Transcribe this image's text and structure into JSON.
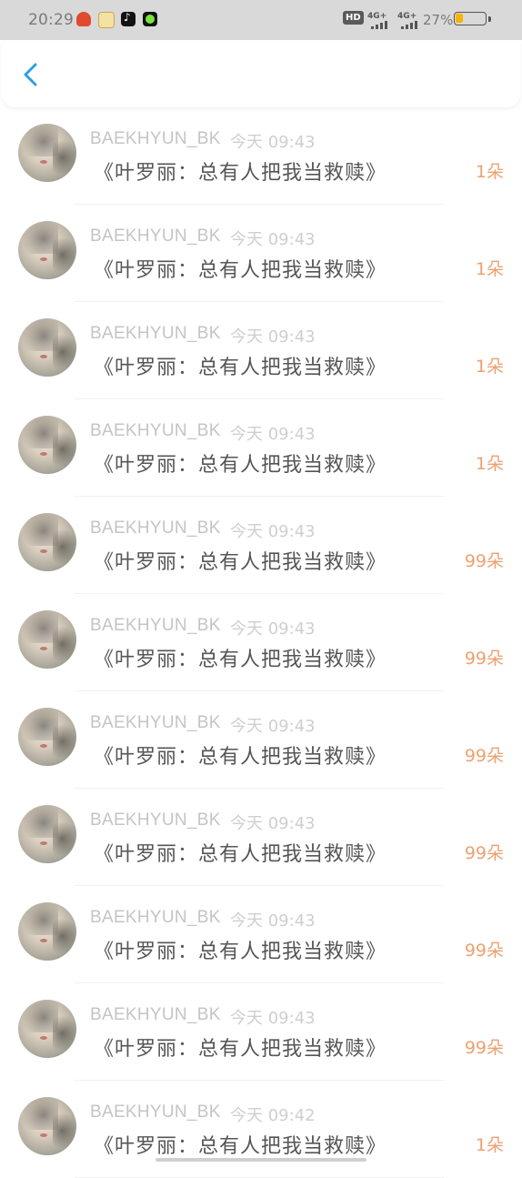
{
  "status_bar": {
    "time": "20:29",
    "app_icons": [
      "weibo-icon",
      "notes-icon",
      "tiktok-icon",
      "app-icon"
    ],
    "hd_label": "HD",
    "signal_1": "4G+",
    "signal_2": "4G+",
    "battery_percent": "27%",
    "battery_level": 0.27,
    "battery_color": "#f5b400"
  },
  "header": {
    "back_icon": "chevron-left-icon",
    "accent_color": "#2e9fe0"
  },
  "list": [
    {
      "user": "BAEKHYUN_BK",
      "time": "今天 09:43",
      "title": "《叶罗丽：总有人把我当救赎》",
      "gift": "1朵"
    },
    {
      "user": "BAEKHYUN_BK",
      "time": "今天 09:43",
      "title": "《叶罗丽：总有人把我当救赎》",
      "gift": "1朵"
    },
    {
      "user": "BAEKHYUN_BK",
      "time": "今天 09:43",
      "title": "《叶罗丽：总有人把我当救赎》",
      "gift": "1朵"
    },
    {
      "user": "BAEKHYUN_BK",
      "time": "今天 09:43",
      "title": "《叶罗丽：总有人把我当救赎》",
      "gift": "1朵"
    },
    {
      "user": "BAEKHYUN_BK",
      "time": "今天 09:43",
      "title": "《叶罗丽：总有人把我当救赎》",
      "gift": "99朵"
    },
    {
      "user": "BAEKHYUN_BK",
      "time": "今天 09:43",
      "title": "《叶罗丽：总有人把我当救赎》",
      "gift": "99朵"
    },
    {
      "user": "BAEKHYUN_BK",
      "time": "今天 09:43",
      "title": "《叶罗丽：总有人把我当救赎》",
      "gift": "99朵"
    },
    {
      "user": "BAEKHYUN_BK",
      "time": "今天 09:43",
      "title": "《叶罗丽：总有人把我当救赎》",
      "gift": "99朵"
    },
    {
      "user": "BAEKHYUN_BK",
      "time": "今天 09:43",
      "title": "《叶罗丽：总有人把我当救赎》",
      "gift": "99朵"
    },
    {
      "user": "BAEKHYUN_BK",
      "time": "今天 09:43",
      "title": "《叶罗丽：总有人把我当救赎》",
      "gift": "99朵"
    },
    {
      "user": "BAEKHYUN_BK",
      "time": "今天 09:42",
      "title": "《叶罗丽：总有人把我当救赎》",
      "gift": "1朵"
    }
  ],
  "colors": {
    "gift": "#eda172",
    "username": "#c4c4c4",
    "title": "#555555"
  }
}
